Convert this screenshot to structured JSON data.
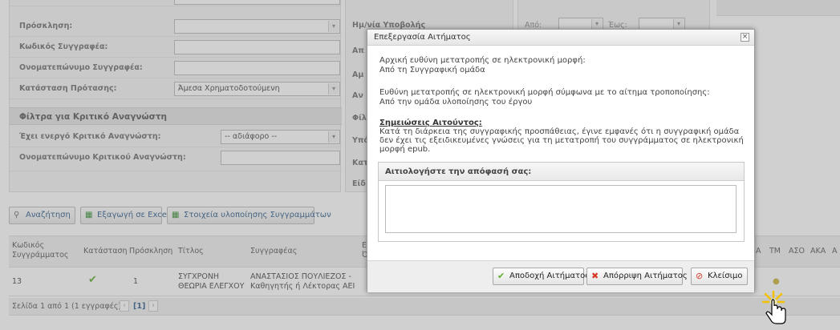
{
  "filters": {
    "rows": [
      {
        "label": "Πρόσκληση:",
        "value": "",
        "type": "select"
      },
      {
        "label": "Κωδικός Συγγραφέα:",
        "value": "",
        "type": "text"
      },
      {
        "label": "Ονοματεπώνυμο Συγγραφέα:",
        "value": "",
        "type": "text"
      },
      {
        "label": "Κατάσταση Πρότασης:",
        "value": "Άμεσα Χρηματοδοτούμενη",
        "type": "select"
      }
    ],
    "critic_section_title": "Φίλτρα για Κριτικό Αναγνώστη",
    "critic_rows": [
      {
        "label": "Έχει ενεργό Κριτικό Αναγνώστη:",
        "value": "-- αδιάφορο --",
        "type": "select"
      },
      {
        "label": "Ονοματεπώνυμο Κριτικού Αναγνώστη:",
        "value": "",
        "type": "text"
      }
    ]
  },
  "mid_filters": {
    "submission_date_label": "Ημ/νία Υποβολής",
    "partial_labels": [
      "Απ",
      "Αμ",
      "Αν",
      "Φίλ",
      "Υπό",
      "Κατ",
      "Είδ"
    ]
  },
  "date_range": {
    "from_label": "Από:",
    "to_label": "Έως:"
  },
  "toolbar": {
    "search": "Αναζήτηση",
    "export": "Εξαγωγή σε Excel",
    "details": "Στοιχεία υλοποίησης Συγγραμμάτων"
  },
  "grid": {
    "headers": [
      "Κωδικός Συγγράμματος",
      "Κατάσταση",
      "Πρόσκληση",
      "Τίτλος",
      "Συγγραφέας",
      "ΤΜ",
      "ΑΣΟ",
      "ΑΚΑ"
    ],
    "header_partial_1": "Ε",
    "header_partial_2": "Ό",
    "header_partial_3": "Α",
    "header_partial_4": "Α",
    "rows": [
      {
        "code": "13",
        "status_icon": "check-icon",
        "call": "1",
        "title_1": "ΣΥΓΧΡΟΝΗ",
        "title_2": "ΘΕΩΡΙΑ ΕΛΕΓΧΟΥ",
        "author_1": "ΑΝΑΣΤΑΣΙΟΣ ΠΟΥΛΙΕΖΟΣ -",
        "author_2": "Καθηγητής ή Λέκτορας ΑΕΙ"
      }
    ],
    "pager_text": "Σελίδα 1 από 1 (1 εγγραφές)",
    "pager_current": "[1]"
  },
  "dialog": {
    "title": "Επεξεργασία Αιτήματος",
    "initial_label": "Αρχική ευθύνη μετατροπής σε ηλεκτρονική μορφή:",
    "initial_value": "Από τη Συγγραφική ομάδα",
    "requested_label": "Ευθύνη μετατροπής σε ηλεκτρονική μορφή σύμφωνα με το αίτημα τροποποίησης:",
    "requested_value": "Από την ομάδα υλοποίησης του έργου",
    "notes_label": "Σημειώσεις Αιτούντος:",
    "notes_line_1": "Κατά τη διάρκεια της συγγραφικής προσπάθειας, έγινε εμφανές ότι η συγγραφική ομάδα",
    "notes_line_2": "δεν έχει τις εξειδικευμένες γνώσεις για τη μετατροπή του συγγράμματος σε ηλεκτρονική",
    "notes_line_3": "μορφή epub.",
    "reason_label": "Αιτιολογήστε την απόφασή σας:",
    "reason_value": "",
    "accept": "Αποδοχή Αιτήματος",
    "reject": "Απόρριψη Αιτήματος",
    "close": "Κλείσιμο"
  },
  "colors": {
    "accent_green": "#5cae2b",
    "reject_red": "#d63b2a",
    "link_blue": "#2a5a8a"
  }
}
